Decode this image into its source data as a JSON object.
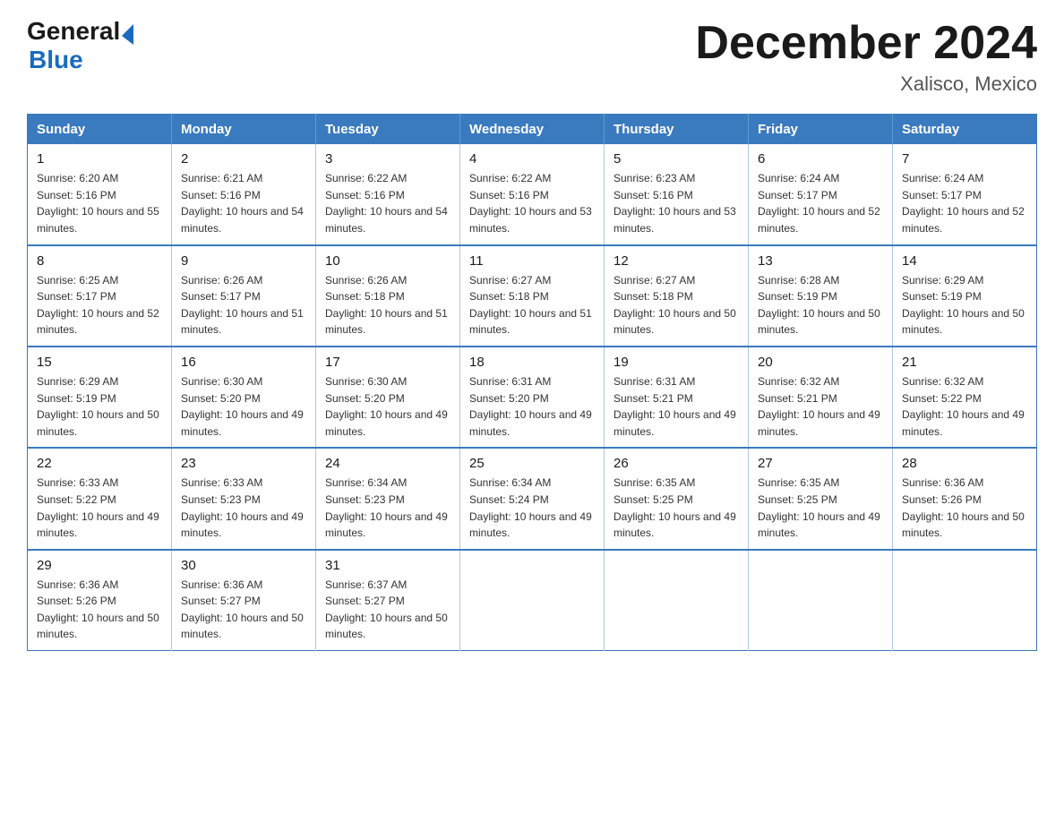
{
  "logo": {
    "general": "General",
    "blue": "Blue",
    "arrow": "▶"
  },
  "title": "December 2024",
  "location": "Xalisco, Mexico",
  "weekdays": [
    "Sunday",
    "Monday",
    "Tuesday",
    "Wednesday",
    "Thursday",
    "Friday",
    "Saturday"
  ],
  "weeks": [
    [
      {
        "day": "1",
        "sunrise": "6:20 AM",
        "sunset": "5:16 PM",
        "daylight": "10 hours and 55 minutes."
      },
      {
        "day": "2",
        "sunrise": "6:21 AM",
        "sunset": "5:16 PM",
        "daylight": "10 hours and 54 minutes."
      },
      {
        "day": "3",
        "sunrise": "6:22 AM",
        "sunset": "5:16 PM",
        "daylight": "10 hours and 54 minutes."
      },
      {
        "day": "4",
        "sunrise": "6:22 AM",
        "sunset": "5:16 PM",
        "daylight": "10 hours and 53 minutes."
      },
      {
        "day": "5",
        "sunrise": "6:23 AM",
        "sunset": "5:16 PM",
        "daylight": "10 hours and 53 minutes."
      },
      {
        "day": "6",
        "sunrise": "6:24 AM",
        "sunset": "5:17 PM",
        "daylight": "10 hours and 52 minutes."
      },
      {
        "day": "7",
        "sunrise": "6:24 AM",
        "sunset": "5:17 PM",
        "daylight": "10 hours and 52 minutes."
      }
    ],
    [
      {
        "day": "8",
        "sunrise": "6:25 AM",
        "sunset": "5:17 PM",
        "daylight": "10 hours and 52 minutes."
      },
      {
        "day": "9",
        "sunrise": "6:26 AM",
        "sunset": "5:17 PM",
        "daylight": "10 hours and 51 minutes."
      },
      {
        "day": "10",
        "sunrise": "6:26 AM",
        "sunset": "5:18 PM",
        "daylight": "10 hours and 51 minutes."
      },
      {
        "day": "11",
        "sunrise": "6:27 AM",
        "sunset": "5:18 PM",
        "daylight": "10 hours and 51 minutes."
      },
      {
        "day": "12",
        "sunrise": "6:27 AM",
        "sunset": "5:18 PM",
        "daylight": "10 hours and 50 minutes."
      },
      {
        "day": "13",
        "sunrise": "6:28 AM",
        "sunset": "5:19 PM",
        "daylight": "10 hours and 50 minutes."
      },
      {
        "day": "14",
        "sunrise": "6:29 AM",
        "sunset": "5:19 PM",
        "daylight": "10 hours and 50 minutes."
      }
    ],
    [
      {
        "day": "15",
        "sunrise": "6:29 AM",
        "sunset": "5:19 PM",
        "daylight": "10 hours and 50 minutes."
      },
      {
        "day": "16",
        "sunrise": "6:30 AM",
        "sunset": "5:20 PM",
        "daylight": "10 hours and 49 minutes."
      },
      {
        "day": "17",
        "sunrise": "6:30 AM",
        "sunset": "5:20 PM",
        "daylight": "10 hours and 49 minutes."
      },
      {
        "day": "18",
        "sunrise": "6:31 AM",
        "sunset": "5:20 PM",
        "daylight": "10 hours and 49 minutes."
      },
      {
        "day": "19",
        "sunrise": "6:31 AM",
        "sunset": "5:21 PM",
        "daylight": "10 hours and 49 minutes."
      },
      {
        "day": "20",
        "sunrise": "6:32 AM",
        "sunset": "5:21 PM",
        "daylight": "10 hours and 49 minutes."
      },
      {
        "day": "21",
        "sunrise": "6:32 AM",
        "sunset": "5:22 PM",
        "daylight": "10 hours and 49 minutes."
      }
    ],
    [
      {
        "day": "22",
        "sunrise": "6:33 AM",
        "sunset": "5:22 PM",
        "daylight": "10 hours and 49 minutes."
      },
      {
        "day": "23",
        "sunrise": "6:33 AM",
        "sunset": "5:23 PM",
        "daylight": "10 hours and 49 minutes."
      },
      {
        "day": "24",
        "sunrise": "6:34 AM",
        "sunset": "5:23 PM",
        "daylight": "10 hours and 49 minutes."
      },
      {
        "day": "25",
        "sunrise": "6:34 AM",
        "sunset": "5:24 PM",
        "daylight": "10 hours and 49 minutes."
      },
      {
        "day": "26",
        "sunrise": "6:35 AM",
        "sunset": "5:25 PM",
        "daylight": "10 hours and 49 minutes."
      },
      {
        "day": "27",
        "sunrise": "6:35 AM",
        "sunset": "5:25 PM",
        "daylight": "10 hours and 49 minutes."
      },
      {
        "day": "28",
        "sunrise": "6:36 AM",
        "sunset": "5:26 PM",
        "daylight": "10 hours and 50 minutes."
      }
    ],
    [
      {
        "day": "29",
        "sunrise": "6:36 AM",
        "sunset": "5:26 PM",
        "daylight": "10 hours and 50 minutes."
      },
      {
        "day": "30",
        "sunrise": "6:36 AM",
        "sunset": "5:27 PM",
        "daylight": "10 hours and 50 minutes."
      },
      {
        "day": "31",
        "sunrise": "6:37 AM",
        "sunset": "5:27 PM",
        "daylight": "10 hours and 50 minutes."
      },
      null,
      null,
      null,
      null
    ]
  ]
}
